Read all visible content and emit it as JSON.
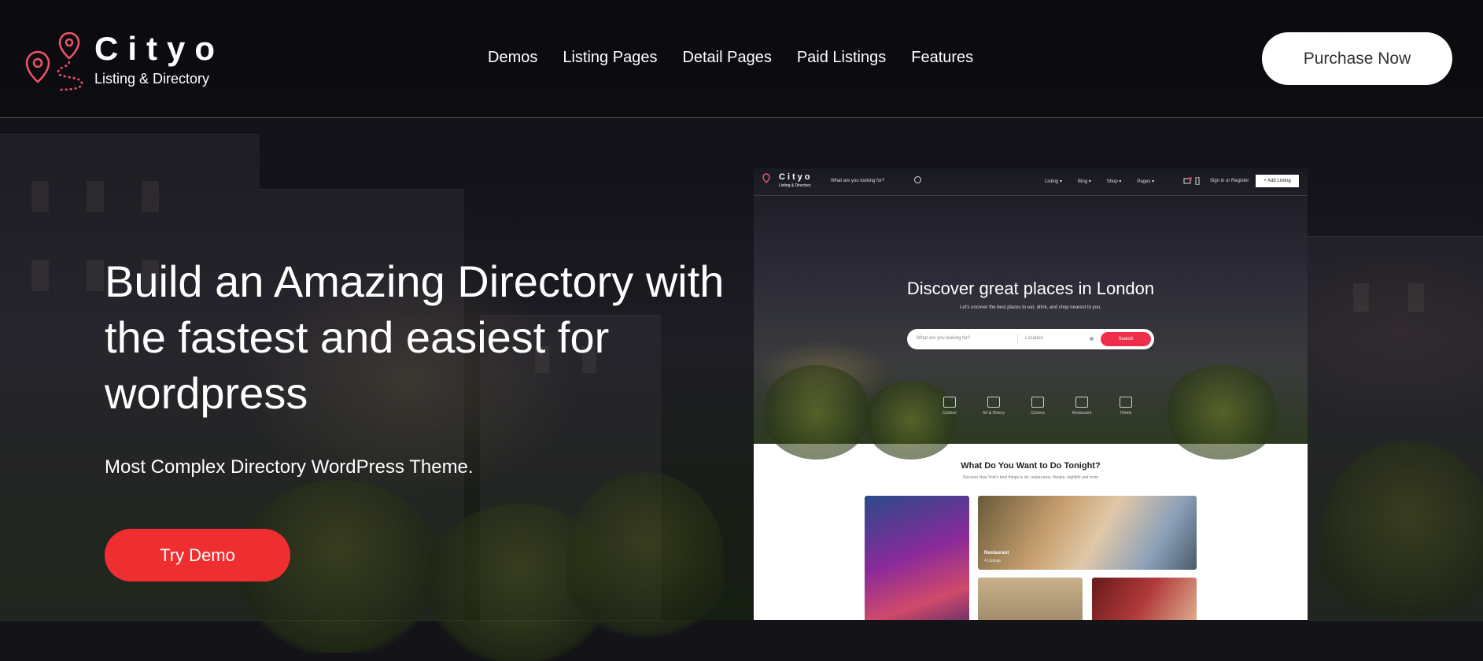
{
  "brand": {
    "name": "Cityo",
    "tagline": "Listing & Directory"
  },
  "nav": {
    "items": [
      {
        "label": "Demos"
      },
      {
        "label": "Listing Pages"
      },
      {
        "label": "Detail Pages"
      },
      {
        "label": "Paid Listings"
      },
      {
        "label": "Features"
      }
    ]
  },
  "header": {
    "cta_label": "Purchase Now"
  },
  "hero": {
    "title": "Build an Amazing Directory with the fastest and easiest for wordpress",
    "subtitle": "Most Complex Directory WordPress Theme.",
    "cta_label": "Try Demo"
  },
  "preview": {
    "brand_name": "Cityo",
    "brand_tagline": "Listing & Directory",
    "search_placeholder": "What are you looking for?",
    "menu": [
      "Listing ▾",
      "Blog ▾",
      "Shop ▾",
      "Pages ▾"
    ],
    "sign_in": "Sign in  or  Register",
    "add_listing": "+ Add Listing",
    "heading": "Discover great places in London",
    "subheading": "Let's uncover the best places to eat, drink, and shop nearest to you.",
    "bar_query": "What are you looking for?",
    "bar_location": "Location",
    "bar_button": "Search",
    "categories": [
      "Outdoor",
      "Art & History",
      "Cinema",
      "Restaurant",
      "Hotels"
    ],
    "section_title": "What Do You Want to Do Tonight?",
    "section_sub": "Discover New York's best things to do, restaurants, theatre, nightlife and more",
    "card_label": "Restaurant",
    "card_count": "4 Listings"
  },
  "colors": {
    "accent": "#ef2f2f",
    "logo_pink": "#f0536b",
    "white": "#ffffff"
  }
}
